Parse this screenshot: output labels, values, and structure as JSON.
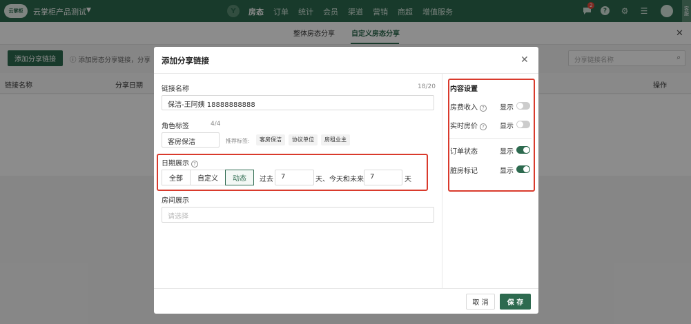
{
  "topnav": {
    "logo_text": "云掌柜",
    "app_name": "云掌柜产品测试",
    "menu_icon_label": "Y",
    "items": [
      "房态",
      "订单",
      "统计",
      "会员",
      "渠道",
      "营销",
      "商超",
      "增值服务"
    ],
    "active_item": "房态",
    "message_badge": "2",
    "side_tab": "客服"
  },
  "subtabs": [
    "整体房态分享",
    "自定义房态分享"
  ],
  "toolbar": {
    "add_button": "添加分享链接",
    "hint": "ⓘ 添加房态分享链接，分享",
    "search_placeholder": "分享链接名称"
  },
  "table": {
    "headers": [
      "链接名称",
      "分享日期",
      "操作"
    ]
  },
  "modal": {
    "title": "添加分享链接",
    "link_name": {
      "label": "链接名称",
      "counter": "18/20",
      "value": "保洁-王阿姨 18888888888"
    },
    "role_tag": {
      "label": "角色标签",
      "counter": "4/4",
      "value": "客房保洁",
      "recommend_label": "推荐标签:",
      "chips": [
        "客房保洁",
        "协议单位",
        "房租业主"
      ]
    },
    "date_display": {
      "label": "日期展示",
      "options": [
        "全部",
        "自定义",
        "动态"
      ],
      "active": "动态",
      "past_label": "过去",
      "past_value": "7",
      "mid_label": "天、今天和未来",
      "future_value": "7",
      "end_label": "天"
    },
    "room_display": {
      "label": "房间展示",
      "placeholder": "请选择"
    },
    "content_settings": {
      "title": "内容设置",
      "items": [
        {
          "label": "房费收入",
          "has_help": true,
          "toggle_label": "显示",
          "on": false
        },
        {
          "label": "实时房价",
          "has_help": true,
          "toggle_label": "显示",
          "on": false
        },
        {
          "label": "订单状态",
          "has_help": false,
          "toggle_label": "显示",
          "on": true
        },
        {
          "label": "脏房标记",
          "has_help": false,
          "toggle_label": "显示",
          "on": true
        }
      ]
    },
    "cancel_button": "取 消",
    "save_button": "保 存"
  },
  "colors": {
    "brand": "#2d6a4f",
    "highlight": "#d93a2c"
  }
}
